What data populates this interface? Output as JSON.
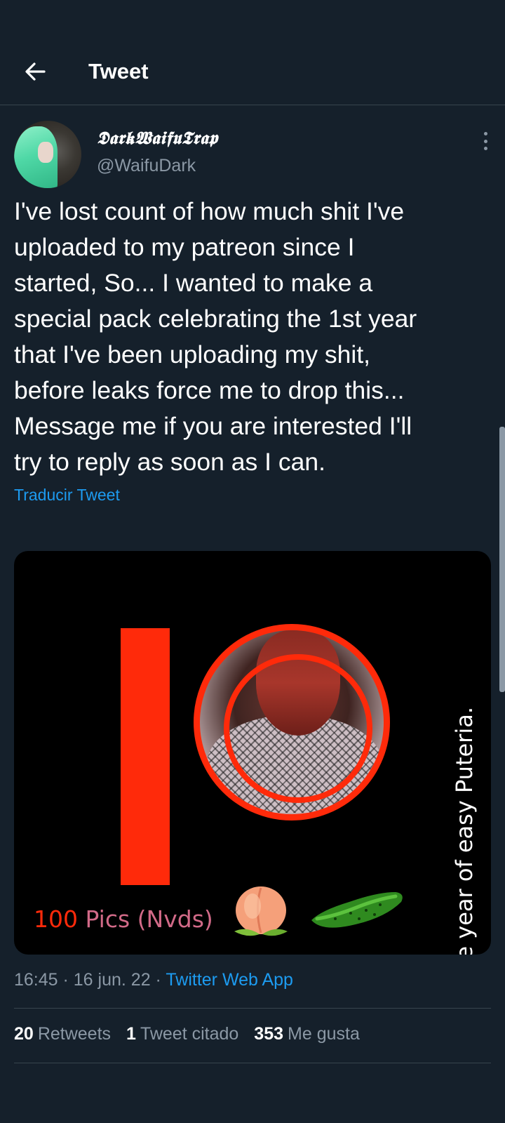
{
  "header": {
    "title": "Tweet"
  },
  "author": {
    "display_name": "𝕯𝖆𝖗𝖐𝖂𝖆𝖎𝖋𝖚𝕿𝖗𝖆𝖕",
    "handle": "@WaifuDark"
  },
  "tweet": {
    "text": "I've lost count of how much shit I've\nuploaded to my patreon since I\nstarted, So... I wanted to make a\nspecial pack celebrating the 1st year\nthat I've been uploading my shit,\nbefore leaks force me to drop this...\nMessage me if you are interested I'll\ntry to reply as soon as I can.",
    "translate_label": "Traducir Tweet"
  },
  "media": {
    "side_text": "One year of easy Puteria.",
    "pics_number": "100",
    "pics_rest": "Pics (Nvds)"
  },
  "meta": {
    "time": "16:45",
    "sep1": " · ",
    "date": "16 jun. 22",
    "sep2": " · ",
    "source": "Twitter Web App"
  },
  "stats": {
    "retweets_count": "20",
    "retweets_label": "Retweets",
    "quotes_count": "1",
    "quotes_label": "Tweet citado",
    "likes_count": "353",
    "likes_label": "Me gusta"
  },
  "colors": {
    "background": "#15202b",
    "accent": "#1d9bf0",
    "patreon": "#ff2a0a",
    "muted": "#8b98a5"
  }
}
